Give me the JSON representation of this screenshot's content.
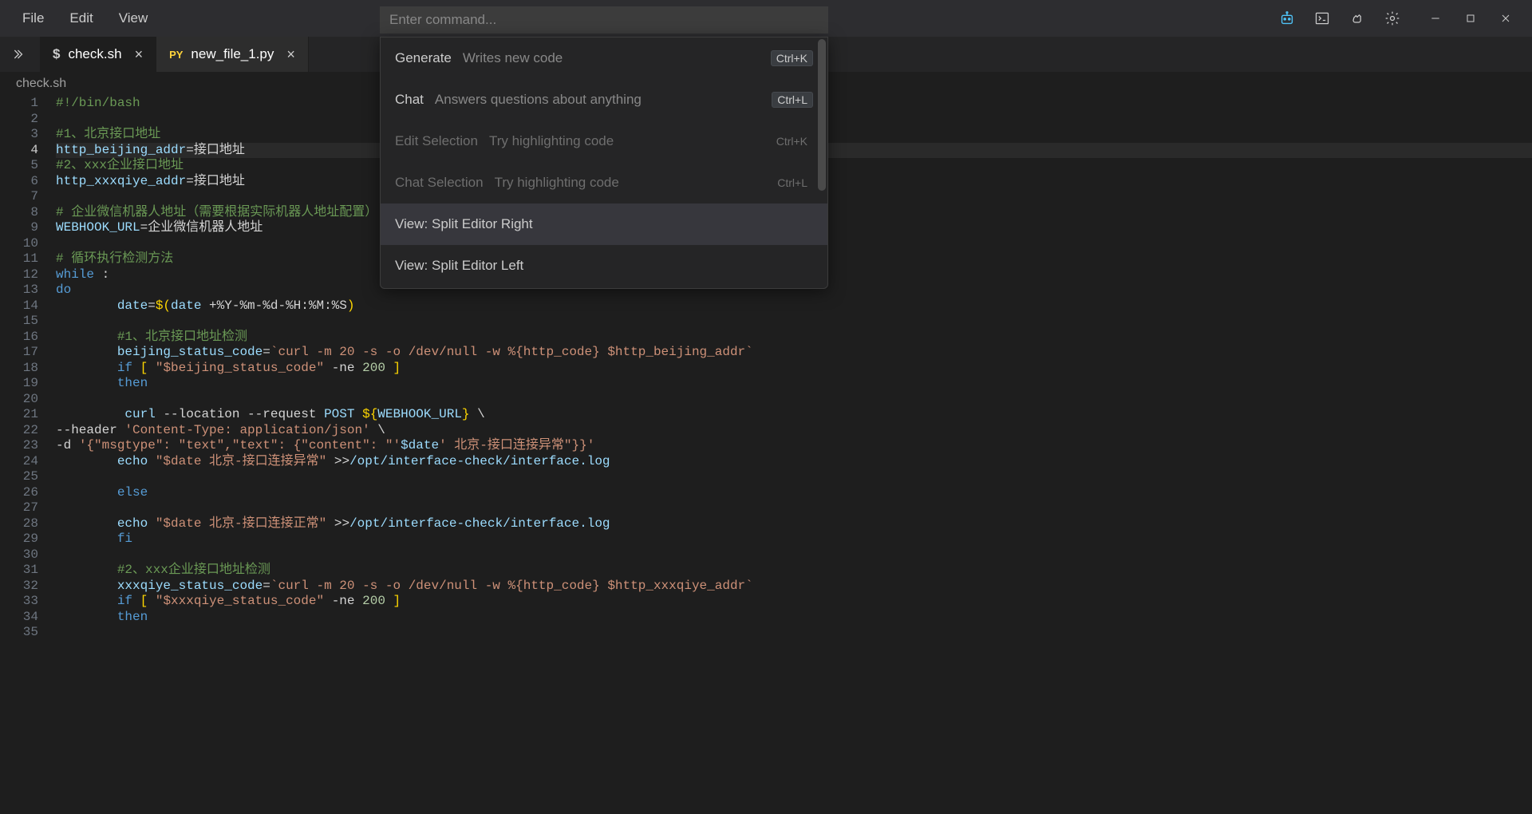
{
  "menubar": {
    "items": [
      "File",
      "Edit",
      "View"
    ]
  },
  "command_input": {
    "placeholder": "Enter command..."
  },
  "tabs": [
    {
      "icon": "$",
      "label": "check.sh",
      "active": true
    },
    {
      "icon": "PY",
      "label": "new_file_1.py",
      "active": false
    }
  ],
  "breadcrumb": "check.sh",
  "palette": {
    "items": [
      {
        "label": "Generate",
        "hint": "Writes new code",
        "shortcut": "Ctrl+K",
        "disabled": false
      },
      {
        "label": "Chat",
        "hint": "Answers questions about anything",
        "shortcut": "Ctrl+L",
        "disabled": false
      },
      {
        "label": "Edit Selection",
        "hint": "Try highlighting code",
        "shortcut": "Ctrl+K",
        "disabled": true
      },
      {
        "label": "Chat Selection",
        "hint": "Try highlighting code",
        "shortcut": "Ctrl+L",
        "disabled": true
      },
      {
        "label": "View: Split Editor Right",
        "hint": "",
        "shortcut": "",
        "disabled": false,
        "selected": true
      },
      {
        "label": "View: Split Editor Left",
        "hint": "",
        "shortcut": "",
        "disabled": false
      }
    ]
  },
  "editor": {
    "current_line": 4,
    "lines": [
      {
        "n": 1,
        "html": "<span class=\"tok-comment\">#!/bin/bash</span>"
      },
      {
        "n": 2,
        "html": ""
      },
      {
        "n": 3,
        "html": "<span class=\"tok-comment\">#1、北京接口地址</span>"
      },
      {
        "n": 4,
        "html": "<span class=\"tok-var\">http_beijing_addr</span><span class=\"tok-op\">=</span>接口地址"
      },
      {
        "n": 5,
        "html": "<span class=\"tok-comment\">#2、xxx企业接口地址</span>"
      },
      {
        "n": 6,
        "html": "<span class=\"tok-var\">http_xxxqiye_addr</span><span class=\"tok-op\">=</span>接口地址"
      },
      {
        "n": 7,
        "html": ""
      },
      {
        "n": 8,
        "html": "<span class=\"tok-comment\"># 企业微信机器人地址（需要根据实际机器人地址配置）</span>"
      },
      {
        "n": 9,
        "html": "<span class=\"tok-var\">WEBHOOK_URL</span><span class=\"tok-op\">=</span>企业微信机器人地址"
      },
      {
        "n": 10,
        "html": ""
      },
      {
        "n": 11,
        "html": "<span class=\"tok-comment\"># 循环执行检测方法</span>"
      },
      {
        "n": 12,
        "html": "<span class=\"tok-kw\">while</span> <span class=\"tok-op\">:</span>"
      },
      {
        "n": 13,
        "html": "<span class=\"tok-kw\">do</span>"
      },
      {
        "n": 14,
        "html": "        <span class=\"tok-var\">date</span><span class=\"tok-op\">=</span><span class=\"tok-punc\">$(</span><span class=\"tok-var\">date</span> <span class=\"tok-op\">+%Y-%m-%d-%H:%M:%S</span><span class=\"tok-punc\">)</span>"
      },
      {
        "n": 15,
        "html": ""
      },
      {
        "n": 16,
        "html": "        <span class=\"tok-comment\">#1、北京接口地址检测</span>"
      },
      {
        "n": 17,
        "html": "        <span class=\"tok-var\">beijing_status_code</span><span class=\"tok-op\">=</span><span class=\"tok-str\">`curl -m 20 -s -o /dev/null -w %{http_code} $http_beijing_addr`</span>"
      },
      {
        "n": 18,
        "html": "        <span class=\"tok-kw\">if</span> <span class=\"tok-punc\">[</span> <span class=\"tok-str\">\"$beijing_status_code\"</span> <span class=\"tok-op\">-ne</span> <span class=\"tok-num\">200</span> <span class=\"tok-punc\">]</span>"
      },
      {
        "n": 19,
        "html": "        <span class=\"tok-kw\">then</span>"
      },
      {
        "n": 20,
        "html": ""
      },
      {
        "n": 21,
        "html": "         <span class=\"tok-var\">curl</span> <span class=\"tok-op\">--location --request</span> <span class=\"tok-var\">POST</span> <span class=\"tok-punc\">${</span><span class=\"tok-var\">WEBHOOK_URL</span><span class=\"tok-punc\">}</span> <span class=\"tok-op\">\\</span>"
      },
      {
        "n": 22,
        "html": "<span class=\"tok-op\">--header</span> <span class=\"tok-str\">'Content-Type: application/json'</span> <span class=\"tok-op\">\\</span>"
      },
      {
        "n": 23,
        "html": "<span class=\"tok-op\">-d</span> <span class=\"tok-str\">'{\"msgtype\": \"text\",\"text\": {\"content\": \"'</span><span class=\"tok-var\">$date</span><span class=\"tok-str\">' 北京-接口连接异常\"}}'</span>"
      },
      {
        "n": 24,
        "html": "        <span class=\"tok-var\">echo</span> <span class=\"tok-str\">\"$date 北京-接口连接异常\"</span> <span class=\"tok-op\">&gt;&gt;</span><span class=\"tok-var\">/opt/interface-check/interface.log</span>"
      },
      {
        "n": 25,
        "html": ""
      },
      {
        "n": 26,
        "html": "        <span class=\"tok-kw\">else</span>"
      },
      {
        "n": 27,
        "html": ""
      },
      {
        "n": 28,
        "html": "        <span class=\"tok-var\">echo</span> <span class=\"tok-str\">\"$date 北京-接口连接正常\"</span> <span class=\"tok-op\">&gt;&gt;</span><span class=\"tok-var\">/opt/interface-check/interface.log</span>"
      },
      {
        "n": 29,
        "html": "        <span class=\"tok-kw\">fi</span>"
      },
      {
        "n": 30,
        "html": ""
      },
      {
        "n": 31,
        "html": "        <span class=\"tok-comment\">#2、xxx企业接口地址检测</span>"
      },
      {
        "n": 32,
        "html": "        <span class=\"tok-var\">xxxqiye_status_code</span><span class=\"tok-op\">=</span><span class=\"tok-str\">`curl -m 20 -s -o /dev/null -w %{http_code} $http_xxxqiye_addr`</span>"
      },
      {
        "n": 33,
        "html": "        <span class=\"tok-kw\">if</span> <span class=\"tok-punc\">[</span> <span class=\"tok-str\">\"$xxxqiye_status_code\"</span> <span class=\"tok-op\">-ne</span> <span class=\"tok-num\">200</span> <span class=\"tok-punc\">]</span>"
      },
      {
        "n": 34,
        "html": "        <span class=\"tok-kw\">then</span>"
      },
      {
        "n": 35,
        "html": ""
      }
    ]
  }
}
